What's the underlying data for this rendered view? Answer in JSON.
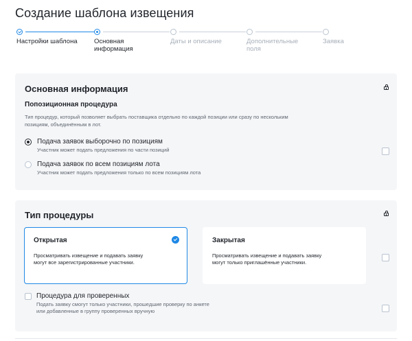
{
  "page": {
    "title": "Создание шаблона извещения"
  },
  "stepper": {
    "steps": [
      {
        "label": "Настройки шаблона",
        "state": "done"
      },
      {
        "label": "Основная информация",
        "state": "current"
      },
      {
        "label": "Даты и описание",
        "state": "pending"
      },
      {
        "label": "Дополнительные поля",
        "state": "pending"
      },
      {
        "label": "Заявка",
        "state": "pending"
      }
    ]
  },
  "basic_info": {
    "title": "Основная информация",
    "lock_icon": "lock-icon",
    "subtitle": "Попозиционная процедура",
    "description": "Тип процедур, который позволяет выбрать поставщика отдельно по каждой позиции или сразу по нескольким позициям, объединённым в лот.",
    "options": [
      {
        "label": "Подача заявок выборочно по позициям",
        "hint": "Участник может подать предложения по части позиций",
        "checked": true
      },
      {
        "label": "Подача заявок по всем позициям лота",
        "hint": "Участник может подать предложения только по всем позициям лота",
        "checked": false
      }
    ]
  },
  "procedure_type": {
    "title": "Тип процедуры",
    "lock_icon": "lock-icon",
    "options": [
      {
        "title": "Открытая",
        "description": "Просматривать извещение и подавать заявку могут все зарегистрированные участники.",
        "selected": true
      },
      {
        "title": "Закрытая",
        "description": "Просматривать извещение и подавать заявку могут только приглашённые участники.",
        "selected": false
      }
    ],
    "verified": {
      "label": "Процедура для проверенных",
      "hint": "Подать заявку смогут только участники, прошедшие проверку по анкете или добавленные в группу проверенных вручную",
      "checked": false
    }
  },
  "colors": {
    "accent": "#1e88e5",
    "card_bg": "#f5f6f8",
    "text": "#1f2329",
    "muted": "#a8b0ba"
  }
}
